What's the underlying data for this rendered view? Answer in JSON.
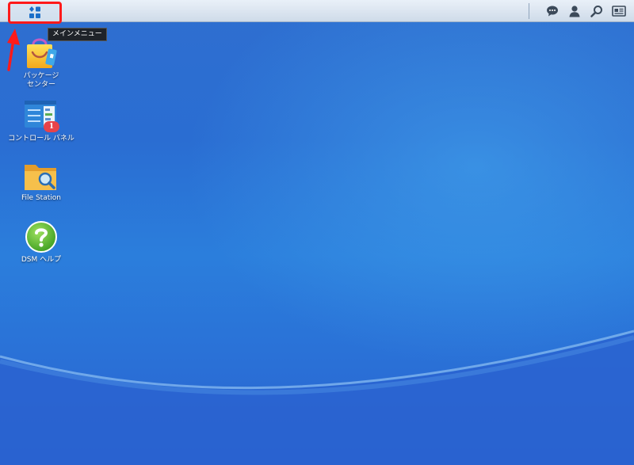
{
  "taskbar": {
    "main_menu_tooltip": "メインメニュー",
    "icons": [
      "chat-icon",
      "user-icon",
      "search-icon",
      "widgets-icon"
    ]
  },
  "desktop": {
    "items": [
      {
        "label": "パッケージ\nセンター",
        "icon": "package-center-icon"
      },
      {
        "label": "コントロール パネル",
        "icon": "control-panel-icon",
        "badge": "1"
      },
      {
        "label": "File Station",
        "icon": "file-station-icon"
      },
      {
        "label": "DSM ヘルプ",
        "icon": "dsm-help-icon"
      }
    ]
  },
  "colors": {
    "highlight": "#ff1a1a",
    "desktop_blue": "#2b7edc",
    "badge": "#e8434a"
  }
}
